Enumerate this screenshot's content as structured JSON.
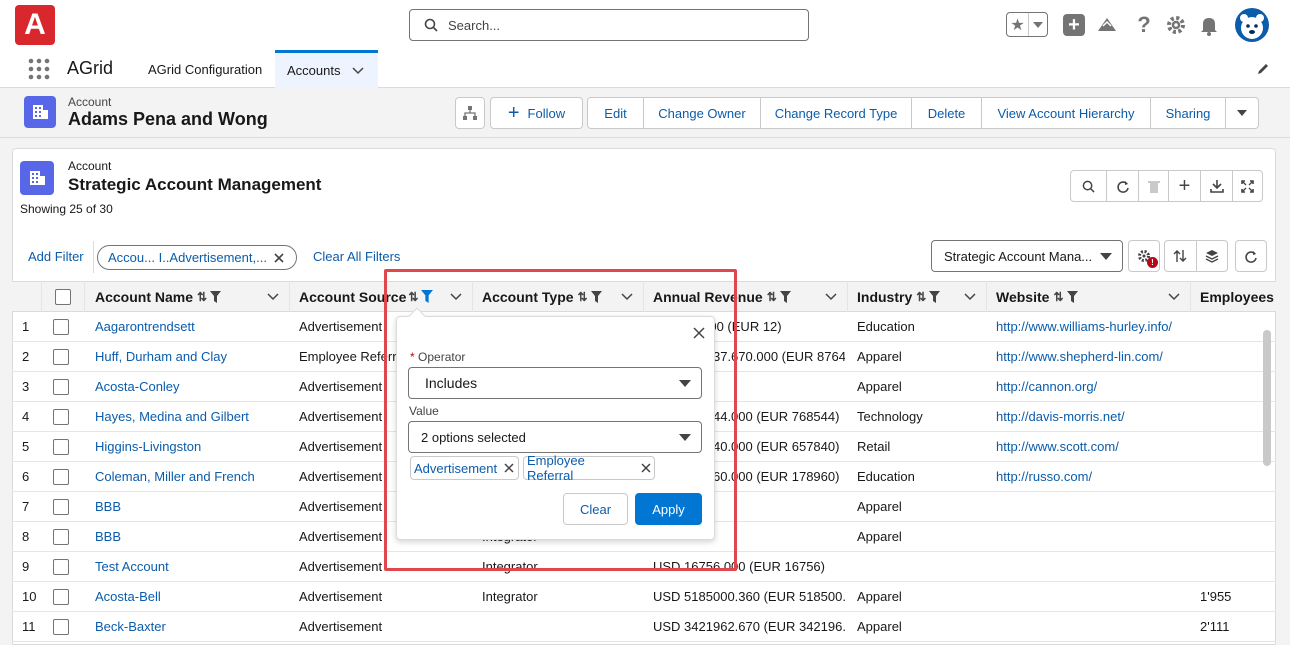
{
  "app": {
    "name": "AGrid",
    "logo_letter": "A"
  },
  "search": {
    "placeholder": "Search..."
  },
  "nav": {
    "tabs": [
      {
        "label": "AGrid Configuration"
      },
      {
        "label": "Accounts"
      }
    ]
  },
  "record": {
    "object_label": "Account",
    "title": "Adams Pena and Wong",
    "actions": [
      "Follow",
      "Edit",
      "Change Owner",
      "Change Record Type",
      "Delete",
      "View Account Hierarchy",
      "Sharing"
    ]
  },
  "grid": {
    "object_label": "Account",
    "title": "Strategic Account Management",
    "showing": "Showing 25 of 30",
    "add_filter": "Add Filter",
    "active_filter_pill": "Accou... I..Advertisement,...",
    "clear_all": "Clear All Filters",
    "view_select": "Strategic Account Mana...",
    "columns": [
      "Account Name",
      "Account Source",
      "Account Type",
      "Annual Revenue",
      "Industry",
      "Website",
      "Employees"
    ],
    "rows": [
      {
        "n": "1",
        "name": "Aagarontrendsett",
        "source": "Advertisement",
        "type": "",
        "revenue": "USD 12.000 (EUR 12)",
        "industry": "Education",
        "website": "http://www.williams-hurley.info/",
        "employees": ""
      },
      {
        "n": "2",
        "name": "Huff, Durham and Clay",
        "source": "Employee Referral",
        "type": "",
        "revenue": "USD 876437.670.000 (EUR 876437...",
        "industry": "Apparel",
        "website": "http://www.shepherd-lin.com/",
        "employees": ""
      },
      {
        "n": "3",
        "name": "Acosta-Conley",
        "source": "Advertisement",
        "type": "",
        "revenue": "",
        "industry": "Apparel",
        "website": "http://cannon.org/",
        "employees": ""
      },
      {
        "n": "4",
        "name": "Hayes, Medina and Gilbert",
        "source": "Advertisement",
        "type": "",
        "revenue": "USD 768544.000 (EUR 768544)",
        "industry": "Technology",
        "website": "http://davis-morris.net/",
        "employees": ""
      },
      {
        "n": "5",
        "name": "Higgins-Livingston",
        "source": "Advertisement",
        "type": "",
        "revenue": "USD 657840.000 (EUR 657840)",
        "industry": "Retail",
        "website": "http://www.scott.com/",
        "employees": ""
      },
      {
        "n": "6",
        "name": "Coleman, Miller and French",
        "source": "Advertisement",
        "type": "",
        "revenue": "USD 178960.000 (EUR 178960)",
        "industry": "Education",
        "website": "http://russo.com/",
        "employees": ""
      },
      {
        "n": "7",
        "name": "BBB",
        "source": "Advertisement",
        "type": "",
        "revenue": "",
        "industry": "Apparel",
        "website": "",
        "employees": ""
      },
      {
        "n": "8",
        "name": "BBB",
        "source": "Advertisement",
        "type": "Integrator",
        "revenue": "",
        "industry": "Apparel",
        "website": "",
        "employees": ""
      },
      {
        "n": "9",
        "name": "Test Account",
        "source": "Advertisement",
        "type": "Integrator",
        "revenue": "USD 16756.000 (EUR 16756)",
        "industry": "",
        "website": "",
        "employees": ""
      },
      {
        "n": "10",
        "name": "Acosta-Bell",
        "source": "Advertisement",
        "type": "Integrator",
        "revenue": "USD 5185000.360 (EUR 518500...",
        "industry": "Apparel",
        "website": "",
        "employees": "1'955"
      },
      {
        "n": "11",
        "name": "Beck-Baxter",
        "source": "Advertisement",
        "type": "",
        "revenue": "USD 3421962.670 (EUR 342196...",
        "industry": "Apparel",
        "website": "",
        "employees": "2'111"
      }
    ]
  },
  "filter_popover": {
    "operator_label": "Operator",
    "required_mark": "*",
    "operator_value": "Includes",
    "value_label": "Value",
    "value_summary": "2 options selected",
    "selected": [
      "Advertisement",
      "Employee Referral"
    ],
    "clear_label": "Clear",
    "apply_label": "Apply"
  },
  "colors": {
    "accent": "#0176d3",
    "link": "#0b5cab",
    "highlight": "#e0474c",
    "logo": "#c23934",
    "record_icon": "#5867e8"
  }
}
